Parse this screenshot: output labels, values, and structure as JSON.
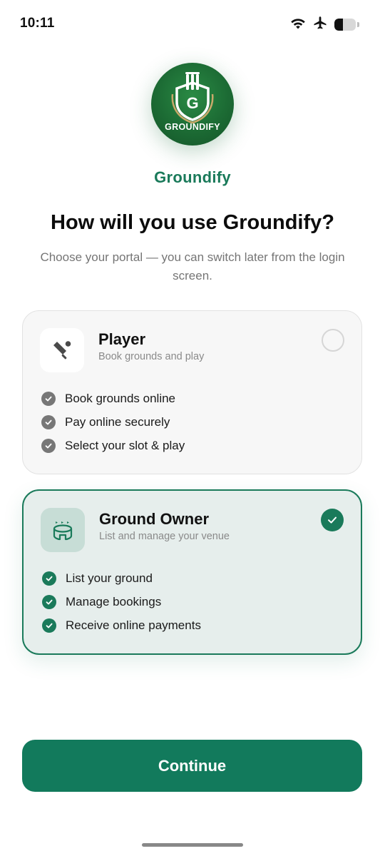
{
  "status_bar": {
    "time": "10:11",
    "battery_level": 0.4
  },
  "logo": {
    "text": "GROUNDIFY",
    "colors": {
      "primary": "#1c6b34",
      "accent": "#c9a86a"
    }
  },
  "brand": {
    "name": "Groundify",
    "color": "#1a7a5a"
  },
  "heading": "How will you use Groundify?",
  "subtext": "Choose your portal — you can switch later from the login screen.",
  "options": [
    {
      "id": "player",
      "title": "Player",
      "subtitle": "Book grounds and play",
      "icon": "cricket-bat-icon",
      "selected": false,
      "features": [
        "Book grounds online",
        "Pay online securely",
        "Select your slot & play"
      ]
    },
    {
      "id": "ground-owner",
      "title": "Ground Owner",
      "subtitle": "List and manage your venue",
      "icon": "stadium-icon",
      "selected": true,
      "features": [
        "List your ground",
        "Manage bookings",
        "Receive online payments"
      ]
    }
  ],
  "continue_label": "Continue",
  "accent_color": "#127a5c"
}
